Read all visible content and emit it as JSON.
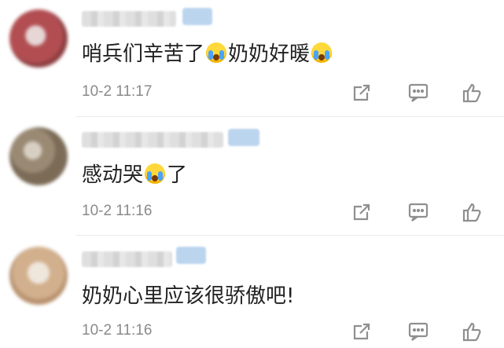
{
  "comments": [
    {
      "text": "哨兵们辛苦了",
      "text2": "奶奶好暖",
      "emoji_count": 2,
      "time": "10-2 11:17",
      "avatar_colors": [
        "#b24e52",
        "#e6d6d6"
      ]
    },
    {
      "text": "感动哭",
      "text2": "了",
      "emoji_count": 1,
      "time": "10-2 11:16",
      "avatar_colors": [
        "#7b6b57",
        "#d8cfc3"
      ]
    },
    {
      "text": "奶奶心里应该很骄傲吧!",
      "text2": "",
      "emoji_count": 0,
      "time": "10-2 11:16",
      "avatar_colors": [
        "#d2b08d",
        "#efe6dc"
      ]
    }
  ],
  "icons": {
    "share": "share-icon",
    "reply": "comment-reply-icon",
    "like": "thumbs-up-icon"
  },
  "colors": {
    "text": "#222222",
    "time": "#8a8a8a",
    "icon": "#8f8f8f",
    "badge": "#bcd5ef"
  }
}
